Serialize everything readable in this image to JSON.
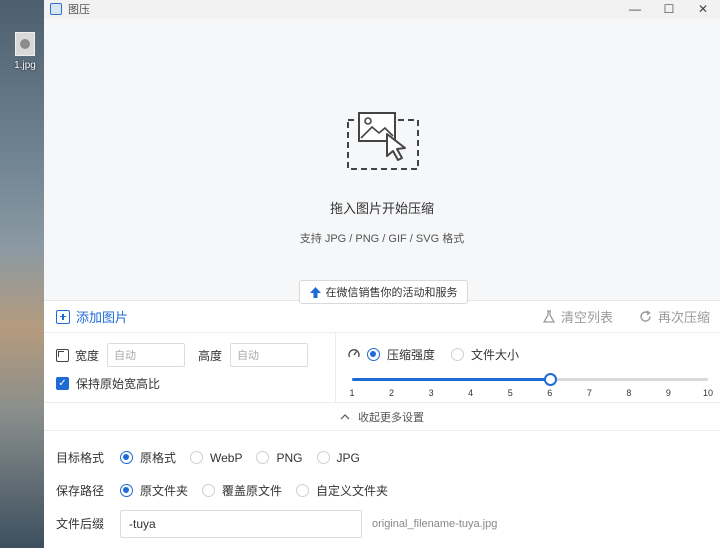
{
  "desktop": {
    "file_label": "1.jpg"
  },
  "window": {
    "title": "图压",
    "controls": {
      "minimize": "—",
      "maximize": "☐",
      "close": "✕"
    }
  },
  "dropzone": {
    "title": "拖入图片开始压缩",
    "subtitle": "支持 JPG / PNG / GIF / SVG 格式",
    "promo_label": "在微信销售你的活动和服务"
  },
  "toolbar": {
    "add_label": "添加图片",
    "clear_label": "清空列表",
    "recompress_label": "再次压缩"
  },
  "size": {
    "width_label": "宽度",
    "width_placeholder": "自动",
    "height_label": "高度",
    "height_placeholder": "自动",
    "keep_ratio_label": "保持原始宽高比",
    "keep_ratio_checked": true
  },
  "compression": {
    "mode_quality_label": "压缩强度",
    "mode_size_label": "文件大小",
    "selected_mode": "quality",
    "slider_value": 6,
    "slider_min": 1,
    "slider_max": 10,
    "ticks": [
      "1",
      "2",
      "3",
      "4",
      "5",
      "6",
      "7",
      "8",
      "9",
      "10"
    ]
  },
  "collapse_label": "收起更多设置",
  "advanced": {
    "format_label": "目标格式",
    "format_options": [
      "原格式",
      "WebP",
      "PNG",
      "JPG"
    ],
    "format_selected": "原格式",
    "path_label": "保存路径",
    "path_options": [
      "原文件夹",
      "覆盖原文件",
      "自定义文件夹"
    ],
    "path_selected": "原文件夹",
    "suffix_label": "文件后缀",
    "suffix_value": "-tuya",
    "suffix_preview": "original_filename-tuya.jpg"
  },
  "colors": {
    "accent": "#1e6bd6",
    "muted": "#9a9a9a"
  }
}
